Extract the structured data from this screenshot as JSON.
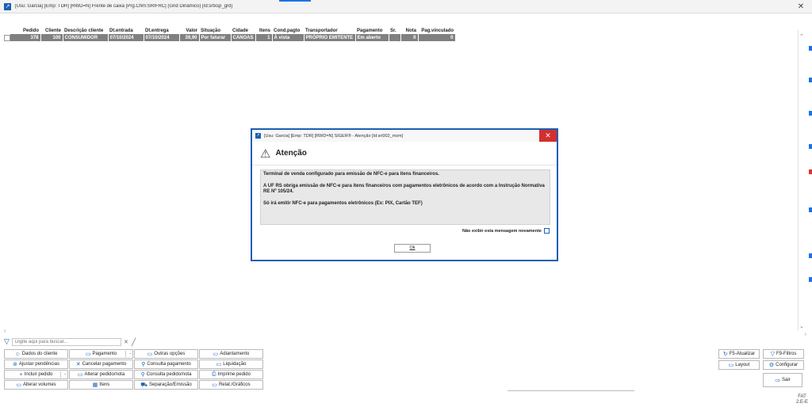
{
  "window": {
    "title": "[Usu: Garcia] [Emp: TDR] [RWD=N] Frente de caixa [Prg.Chm:SRIFRC] (Grid Dinâmico) [Id:srtxsp_grd]",
    "close": "✕"
  },
  "grid": {
    "columns": [
      "Pedido",
      "Cliente",
      "Descrição cliente",
      "Dt.entrada",
      "Dt.entrega",
      "Valor",
      "Situação",
      "Cidade",
      "Itens",
      "Cond.pagto",
      "Transportador",
      "Pagamento",
      "Sr.",
      "Nota",
      "Pag.vinculado"
    ],
    "rows": [
      [
        "378",
        "100",
        "CONSUMIDOR",
        "07/10/2024",
        "07/10/2024",
        "39,90",
        "Por faturar",
        "CANOAS",
        "1",
        "À vista",
        "PRÓPRIO EMITENTE",
        "Em aberto",
        "",
        "0",
        "0"
      ]
    ]
  },
  "search": {
    "placeholder": "Digite aqui para buscar...",
    "clear": "✕"
  },
  "buttons": {
    "dados_cliente": "Dados do cliente",
    "pagamento": "Pagamento",
    "outras_opcoes": "Outras opções",
    "adiantamento": "Adiantamento",
    "ajustar_pendencias": "Ajustar pendências",
    "cancelar_pagamento": "Cancelar pagamento",
    "consulta_pagamento": "Consulta pagamento",
    "liquidacao": "Liquidação",
    "incluir_pedido": "Incluir pedido",
    "alterar_pedido_nota": "Alterar pedido/nota",
    "consulta_pedido_nota": "Consulta pedido/nota",
    "imprime_pedido": "Imprime pedido",
    "alterar_volumes": "Alterar volumes",
    "itens": "Itens",
    "separacao_emissao": "Separação/Emissão",
    "relat_graficos": "Relat./Gráficos"
  },
  "right_buttons": {
    "atualizar": "F5-Atualizar",
    "filtros": "F9-Filtros",
    "layout": "Layout",
    "configurar": "Configurar",
    "sair": "Sair"
  },
  "status": {
    "fat_line1": "FAT",
    "fat_line2": "2.E-E"
  },
  "modal": {
    "title": "[Usu: Garcia] [Emp: TDR] [RWD=N] SIGER® - Atenção [Id:sri002_msm]",
    "close": "✕",
    "heading": "Atenção",
    "message_1": "Terminal de venda configurado para emissão de NFC-e para itens financeiros.",
    "message_2": "A UF RS obriga emissão de NFC-e para itens financeiros com pagamentos eletrônicos de acordo com a Instrução Normativa RE Nº 105/24.",
    "message_3": "Só irá emitir NFC-e para pagamentos eletrônicos (Ex: PIX, Cartão TEF)",
    "dont_show": "Não exibir esta mensagem novamente",
    "ok": "Ok"
  }
}
